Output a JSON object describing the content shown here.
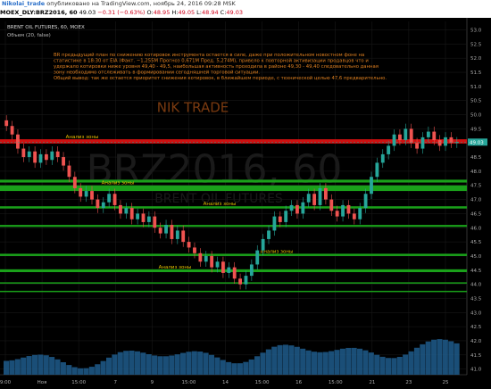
{
  "header": {
    "user": "Nikolai_trade",
    "published": "опубликовано на TradingView.com, ноябрь 24, 2016 09:28 MSK"
  },
  "symbol_bar": {
    "symbol": "MOEX_DLY:BRZ2016, 60",
    "last": "49.03",
    "change": "−0.31 (−0.63%)",
    "o_label": "O:",
    "o": "48.95",
    "h_label": "H:",
    "h": "49.05",
    "l_label": "L:",
    "l": "48.94",
    "c_label": "C:",
    "c": "49.03"
  },
  "chart_data": {
    "type": "candlestick",
    "instrument_label": "BRENT OIL FUTURES, 60, MOEX",
    "volume_label": "Объем (20, false)",
    "watermark": "BRZ2016, 60",
    "watermark_sub": "BRENT OIL FUTURES",
    "brand": "NIK TRADE",
    "analysis_text": [
      "BR предыдущий план по снижению котировок инструмента остается в силе, даже при положительном новостном фоне на",
      "статистике в 18:30 от EIA (Факт. −1,255M Прогноз 0,671M Пред. 5,274M), привело к повторной активизации продавцов что и",
      "удержало котировки ниже уровня 49,40 - 49,5, наибольшая активность проходила в районе 49,30 - 49,40 следовательно данная",
      "зону необходимо отслеживать в формировании сегодняшней торговой ситуации.",
      "Общий вывод: так же остается приоритет снижения котировок, в ближайшем периоде, с технической целью 47,6 предварительно."
    ],
    "y_axis": {
      "ticks": [
        41.0,
        41.5,
        42.0,
        42.5,
        43.0,
        43.5,
        44.0,
        44.5,
        45.0,
        45.5,
        46.0,
        46.5,
        47.0,
        47.5,
        48.0,
        48.5,
        49.0,
        49.5,
        50.0,
        50.5,
        51.0,
        51.5,
        52.0,
        52.5,
        53.0
      ],
      "range": [
        40.8,
        53.3
      ]
    },
    "x_axis": {
      "labels": [
        "9:00",
        "Ноя",
        "15:00",
        "7",
        "9",
        "15:00",
        "14",
        "15:00",
        "16",
        "15:00",
        "21",
        "23",
        "25"
      ]
    },
    "last_price": 49.03,
    "last_price_label": "49.03",
    "zones": [
      {
        "low": 48.98,
        "high": 49.13,
        "color": "#d01010",
        "label": "Анализ зоны"
      },
      {
        "low": 47.6,
        "high": 47.7,
        "color": "#1aa01a",
        "label": ""
      },
      {
        "low": 47.3,
        "high": 47.5,
        "color": "#1aa01a",
        "label": "Анализ зоны"
      },
      {
        "low": 46.68,
        "high": 46.76,
        "color": "#1aa01a",
        "label": "Анализ зоны"
      },
      {
        "low": 46.03,
        "high": 46.1,
        "color": "#1aa01a",
        "label": ""
      },
      {
        "low": 45.0,
        "high": 45.08,
        "color": "#1aa01a",
        "label": "Анализ зоны"
      },
      {
        "low": 44.43,
        "high": 44.53,
        "color": "#1aa01a",
        "label": "Анализ зоны"
      },
      {
        "low": 44.03,
        "high": 44.07,
        "color": "#1aa01a",
        "label": ""
      },
      {
        "low": 43.73,
        "high": 43.77,
        "color": "#1aa01a",
        "label": ""
      }
    ],
    "price_path": [
      49.6,
      49.3,
      48.8,
      48.5,
      48.7,
      48.3,
      48.6,
      48.4,
      48.7,
      48.5,
      48.2,
      47.8,
      47.4,
      47.1,
      47.3,
      47.0,
      46.7,
      46.9,
      47.2,
      46.8,
      46.5,
      46.7,
      46.3,
      46.5,
      46.2,
      46.4,
      46.0,
      45.8,
      46.1,
      45.6,
      45.9,
      45.5,
      45.3,
      45.1,
      44.8,
      45.0,
      44.6,
      44.8,
      44.4,
      44.6,
      44.2,
      44.0,
      44.3,
      44.7,
      45.2,
      45.6,
      45.9,
      46.4,
      46.2,
      46.6,
      46.8,
      46.5,
      46.9,
      47.2,
      46.8,
      47.4,
      47.0,
      46.6,
      46.4,
      46.8,
      46.5,
      46.3,
      46.7,
      47.2,
      47.8,
      48.3,
      48.6,
      48.9,
      49.3,
      49.1,
      49.5,
      49.0,
      48.8,
      49.2,
      49.4,
      49.1,
      48.9,
      49.2,
      49.0,
      49.03
    ],
    "grid": true,
    "colors": {
      "up": "#26a69a",
      "down": "#ef5350",
      "volume": "#1e5c8c"
    }
  }
}
